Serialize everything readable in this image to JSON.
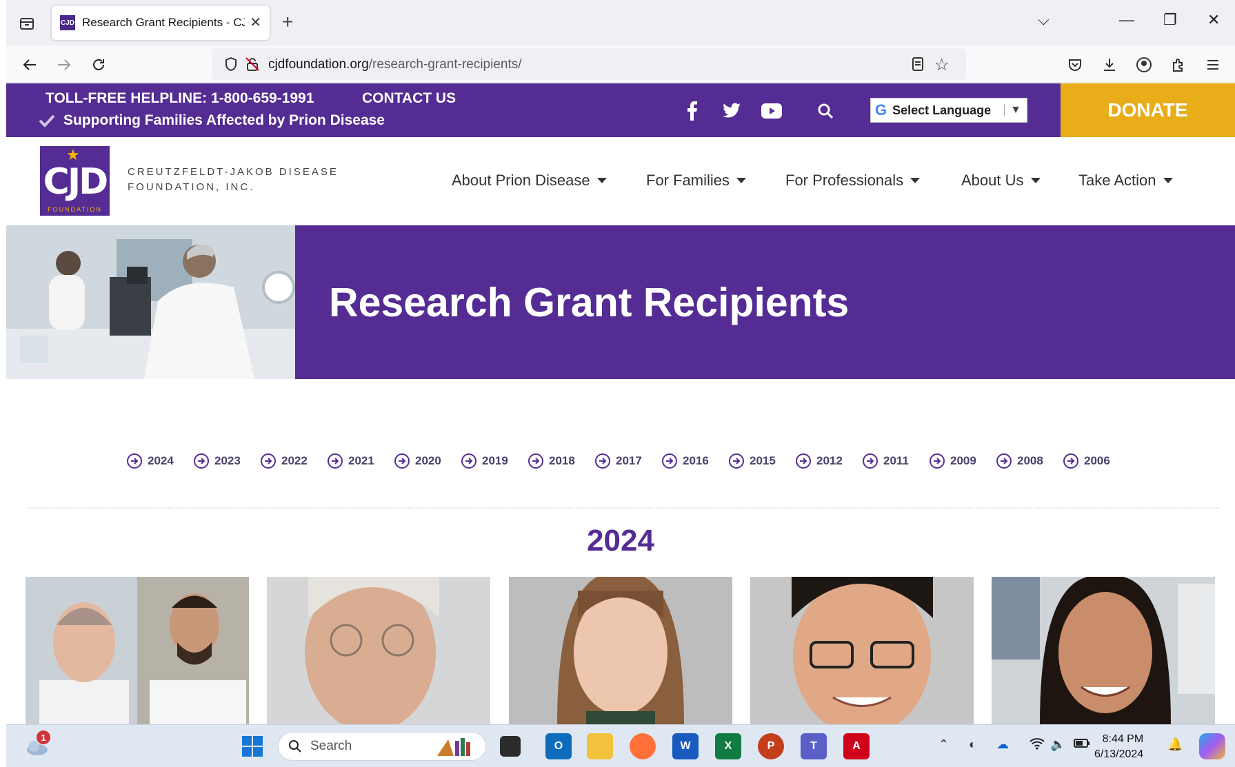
{
  "browser": {
    "tab_title": "Research Grant Recipients - CJD F",
    "tab_favicon": "CJD",
    "url_domain": "cjdfoundation.org",
    "url_path": "/research-grant-recipients/"
  },
  "topbar": {
    "helpline": "TOLL-FREE HELPLINE: 1-800-659-1991",
    "contact": "CONTACT US",
    "tagline": "Supporting Families Affected by Prion Disease",
    "language": "Select Language",
    "donate": "DONATE"
  },
  "header": {
    "logo_text": "CJD",
    "logo_sub": "FOUNDATION",
    "org_line1": "CREUTZFELDT-JAKOB DISEASE",
    "org_line2": "FOUNDATION, INC.",
    "menu": [
      "About Prion Disease",
      "For Families",
      "For Professionals",
      "About Us",
      "Take Action"
    ]
  },
  "hero": {
    "title": "Research Grant Recipients"
  },
  "years": [
    "2024",
    "2023",
    "2022",
    "2021",
    "2020",
    "2019",
    "2018",
    "2017",
    "2016",
    "2015",
    "2012",
    "2011",
    "2009",
    "2008",
    "2006"
  ],
  "section": {
    "year": "2024"
  },
  "taskbar": {
    "search": "Search",
    "time": "8:44 PM",
    "date": "6/13/2024",
    "weather_badge": "1"
  },
  "colors": {
    "brand_purple": "#542c93",
    "donate_gold": "#e9ad1a"
  }
}
